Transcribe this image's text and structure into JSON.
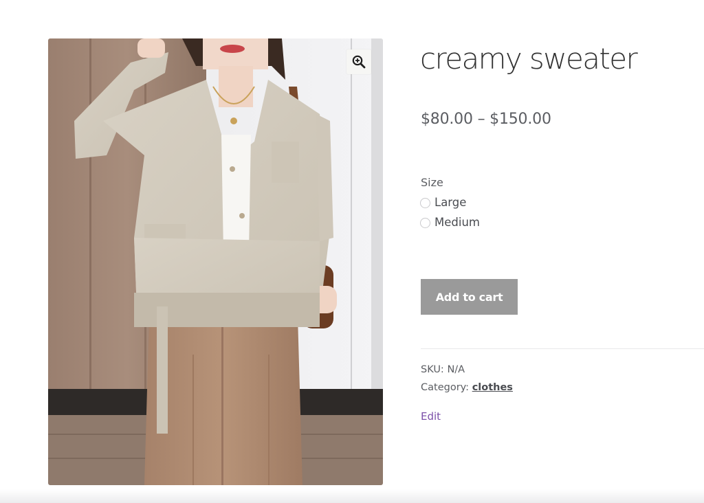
{
  "product": {
    "title": "creamy sweater",
    "price_range": "$80.00 – $150.00",
    "image_alt": "Woman wearing a cream V-neck cardigan with beige trousers",
    "zoom_icon": "zoom-in-icon"
  },
  "variations": {
    "label": "Size",
    "options": [
      {
        "label": "Large",
        "selected": false
      },
      {
        "label": "Medium",
        "selected": false
      }
    ]
  },
  "actions": {
    "add_to_cart_label": "Add to cart",
    "add_to_cart_disabled": true
  },
  "meta": {
    "sku_label": "SKU:",
    "sku_value": "N/A",
    "category_label": "Category:",
    "category_value": "clothes"
  },
  "admin": {
    "edit_label": "Edit"
  },
  "colors": {
    "accent_link": "#7b4fa8",
    "button_bg": "#9a9a9a",
    "text": "#43454b"
  }
}
